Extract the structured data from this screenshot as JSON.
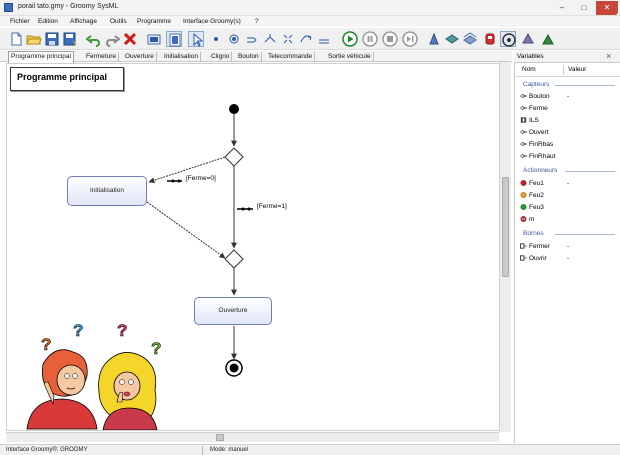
{
  "window": {
    "title": "porail tato.gmy - Groomy SysML",
    "minimize": "–",
    "maximize": "□",
    "close": "✕"
  },
  "menu": [
    "Fichier",
    "Edition",
    "Affichage",
    "Outils",
    "Programme",
    "Interface Groomy(s)",
    "?"
  ],
  "toolbar": {
    "icons": [
      "new-icon",
      "open-icon",
      "save-icon",
      "save-as-icon",
      "undo-icon",
      "redo-icon",
      "delete-icon",
      "view-icon",
      "panel-icon",
      "pointer-icon",
      "initial-node-icon",
      "action-node-icon",
      "decision-node-icon",
      "fork-node-icon",
      "merge-node-icon",
      "flow-icon",
      "transition-icon",
      "run-icon",
      "pause-icon",
      "stop-icon",
      "step-icon",
      "tool-a-icon",
      "tool-b-icon",
      "tool-c-icon",
      "tool-d-icon",
      "robot-icon",
      "connect-icon",
      "settings-icon"
    ]
  },
  "tabs": [
    "Programme principal",
    "Fermeture",
    "Ouverture",
    "Initialisation",
    "Cligno",
    "Bouton",
    "Telecommande",
    "Sortie véhicule"
  ],
  "diagram": {
    "frame_label": "Programme principal",
    "action_1": "Initialisation",
    "action_2": "Ouverture",
    "guard_1": "[Ferme=0]",
    "guard_2": "[Ferme=1]"
  },
  "variables_panel": {
    "title": "Variables",
    "close": "×",
    "columns": [
      "Nom",
      "Valeur"
    ],
    "groups": [
      {
        "label": "Capteurs",
        "items": [
          {
            "name": "Bouton",
            "value": "-",
            "icon": "sensor-icon"
          },
          {
            "name": "Ferme",
            "value": "",
            "icon": "sensor-icon"
          },
          {
            "name": "ILS",
            "value": "",
            "icon": "ils-icon"
          },
          {
            "name": "Ouvert",
            "value": "",
            "icon": "sensor-icon"
          },
          {
            "name": "FinRbas",
            "value": "",
            "icon": "sensor-icon"
          },
          {
            "name": "FinRhaut",
            "value": "",
            "icon": "sensor-icon"
          }
        ]
      },
      {
        "label": "Actionneurs",
        "items": [
          {
            "name": "Feu1",
            "value": "-",
            "icon": "red-light-icon"
          },
          {
            "name": "Feu2",
            "value": "",
            "icon": "orange-light-icon"
          },
          {
            "name": "Feu3",
            "value": "",
            "icon": "green-light-icon"
          },
          {
            "name": "m",
            "value": "",
            "icon": "motor-icon"
          }
        ]
      },
      {
        "label": "Bornes",
        "items": [
          {
            "name": "Fermer",
            "value": "-",
            "icon": "terminal-icon"
          },
          {
            "name": "Ouvrir",
            "value": "-",
            "icon": "terminal-icon"
          }
        ]
      }
    ]
  },
  "status": {
    "left": "Interface Groomy®: GROOMY",
    "mode": "Mode: manuel"
  },
  "colors": {
    "close_red": "#c7453a",
    "node_border": "#6f7fb0",
    "group_blue": "#3a5a9a",
    "run_green": "#1a8a2a",
    "delete_red": "#d01818"
  }
}
